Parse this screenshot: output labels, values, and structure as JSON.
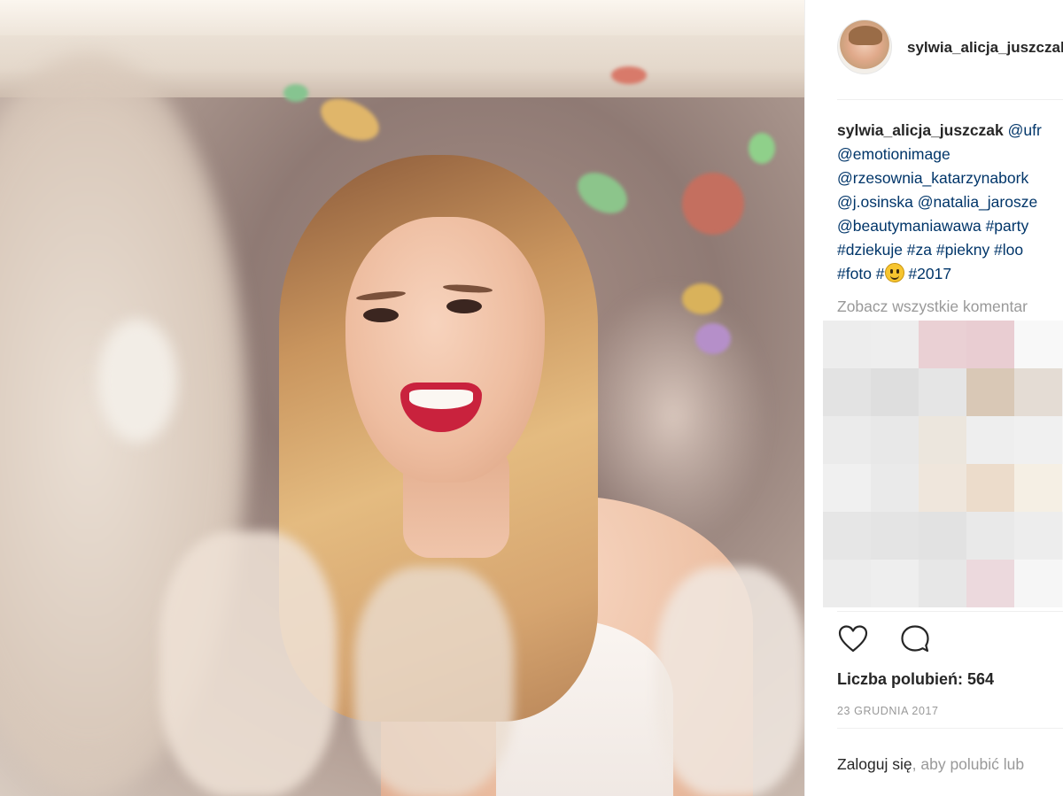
{
  "post": {
    "username": "sylwia_alicja_juszczak",
    "photo_alt": "",
    "caption": {
      "user": "sylwia_alicja_juszczak",
      "lines": [
        "@ufr",
        "@emotionimage",
        "@rzesownia_katarzynabork",
        "@j.osinska @natalia_jarosze",
        "@beautymaniawawa #party",
        "#dziekuje #za #piekny #loo",
        "#foto #",
        "#2017"
      ]
    },
    "view_comments": "Zobacz wszystkie komentar",
    "likes_label": "Liczba polubień:",
    "likes_count": "564",
    "date": "23 GRUDNIA 2017",
    "login_link": "Zaloguj się",
    "login_rest": ", aby polubić lub"
  },
  "icons": {
    "like": "heart-icon",
    "comment": "comment-icon",
    "emoji": "smiley-emoji"
  },
  "colors": {
    "link": "#003569",
    "muted": "#999999",
    "text": "#262626"
  }
}
